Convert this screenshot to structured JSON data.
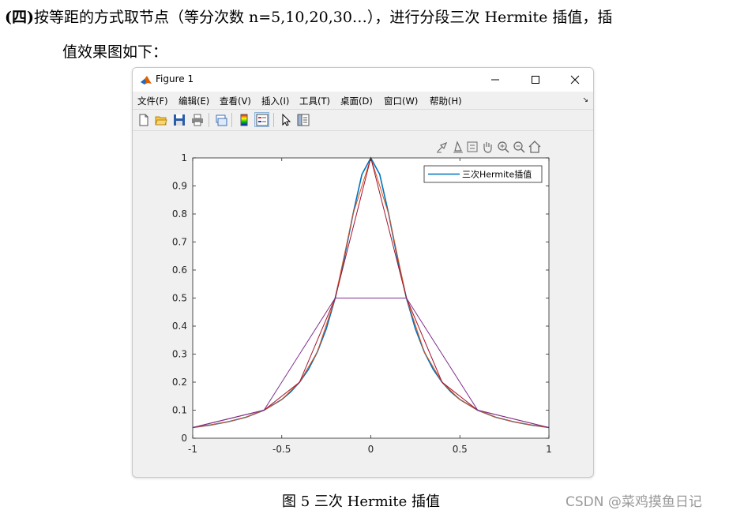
{
  "document": {
    "line1_prefix": "(四)",
    "line1_text": "按等距的方式取节点（等分次数 n=5,10,20,30…），进行分段三次 Hermite 插值，插",
    "line2_text": "值效果图如下：",
    "caption": "图 5  三次 Hermite 插值",
    "watermark": "CSDN @菜鸡摸鱼日记"
  },
  "window": {
    "title": "Figure 1",
    "controls": [
      "minimize",
      "maximize",
      "close"
    ],
    "menu": [
      {
        "label": "文件(F)"
      },
      {
        "label": "编辑(E)"
      },
      {
        "label": "查看(V)"
      },
      {
        "label": "插入(I)"
      },
      {
        "label": "工具(T)"
      },
      {
        "label": "桌面(D)"
      },
      {
        "label": "窗口(W)"
      },
      {
        "label": "帮助(H)"
      }
    ],
    "toolbar_icons": [
      "new-figure-icon",
      "open-file-icon",
      "save-icon",
      "print-icon",
      "link-plot-icon",
      "colorbar-icon",
      "legend-icon",
      "pointer-icon",
      "property-inspector-icon"
    ],
    "axes_toolbar_icons": [
      "brush-icon",
      "data-tips-icon",
      "export-icon",
      "pan-icon",
      "zoom-in-icon",
      "zoom-out-icon",
      "home-icon"
    ]
  },
  "chart_data": {
    "type": "line",
    "title": "",
    "xlabel": "",
    "ylabel": "",
    "xlim": [
      -1,
      1
    ],
    "ylim": [
      0,
      1
    ],
    "xticks": [
      "-1",
      "-0.5",
      "0",
      "0.5",
      "1"
    ],
    "yticks": [
      "0",
      "0.1",
      "0.2",
      "0.3",
      "0.4",
      "0.5",
      "0.6",
      "0.7",
      "0.8",
      "0.9",
      "1"
    ],
    "grid": false,
    "legend": {
      "position": "top-right",
      "entries": [
        "三次Hermite插值"
      ]
    },
    "series": [
      {
        "name": "三次Hermite插值",
        "color": "#0072bd",
        "x": [
          -1,
          -0.9,
          -0.8,
          -0.7,
          -0.6,
          -0.5,
          -0.45,
          -0.4,
          -0.35,
          -0.3,
          -0.25,
          -0.2,
          -0.15,
          -0.1,
          -0.05,
          0,
          0.05,
          0.1,
          0.15,
          0.2,
          0.25,
          0.3,
          0.35,
          0.4,
          0.45,
          0.5,
          0.6,
          0.7,
          0.8,
          0.9,
          1
        ],
        "y": [
          0.038,
          0.047,
          0.059,
          0.075,
          0.1,
          0.138,
          0.165,
          0.2,
          0.246,
          0.308,
          0.39,
          0.5,
          0.64,
          0.8,
          0.941,
          1,
          0.941,
          0.8,
          0.64,
          0.5,
          0.39,
          0.308,
          0.246,
          0.2,
          0.165,
          0.138,
          0.1,
          0.075,
          0.059,
          0.047,
          0.038
        ]
      },
      {
        "color": "#d95319",
        "x": [
          -1,
          -0.9,
          -0.8,
          -0.7,
          -0.6,
          -0.5,
          -0.4,
          -0.3,
          -0.2,
          -0.1,
          0,
          0.1,
          0.2,
          0.3,
          0.4,
          0.5,
          0.6,
          0.7,
          0.8,
          0.9,
          1
        ],
        "y": [
          0.038,
          0.047,
          0.059,
          0.075,
          0.1,
          0.138,
          0.2,
          0.308,
          0.5,
          0.8,
          1,
          0.8,
          0.5,
          0.308,
          0.2,
          0.138,
          0.1,
          0.075,
          0.059,
          0.047,
          0.038
        ]
      },
      {
        "color": "#a2142f",
        "x": [
          -1,
          -0.6,
          -0.4,
          -0.2,
          0,
          0.2,
          0.4,
          0.6,
          1
        ],
        "y": [
          0.038,
          0.1,
          0.2,
          0.5,
          1,
          0.5,
          0.2,
          0.1,
          0.038
        ]
      },
      {
        "color": "#7e2f8e",
        "x": [
          -1,
          -0.6,
          -0.2,
          0.2,
          0.6,
          1
        ],
        "y": [
          0.038,
          0.1,
          0.5,
          0.5,
          0.1,
          0.038
        ]
      }
    ]
  }
}
